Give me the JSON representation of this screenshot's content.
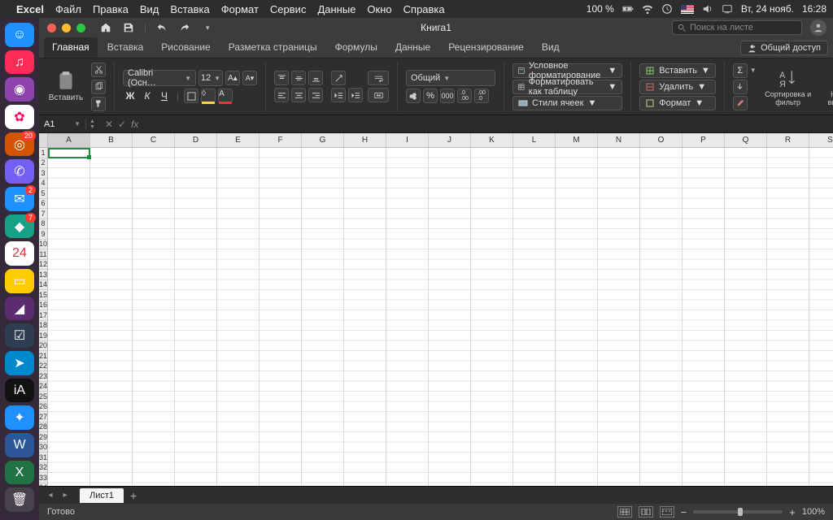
{
  "menubar": {
    "app": "Excel",
    "items": [
      "Файл",
      "Правка",
      "Вид",
      "Вставка",
      "Формат",
      "Сервис",
      "Данные",
      "Окно",
      "Справка"
    ],
    "battery": "100 %",
    "date": "Вт, 24 нояб.",
    "time": "16:28"
  },
  "dock": {
    "apps": [
      {
        "name": "finder",
        "bg": "#1e90ff",
        "glyph": "☺"
      },
      {
        "name": "music",
        "bg": "#ff2d55",
        "glyph": "♫"
      },
      {
        "name": "podcasts",
        "bg": "#8e44ad",
        "glyph": "◉"
      },
      {
        "name": "photos",
        "bg": "#ffffff",
        "glyph": "✿",
        "fg": "#f06"
      },
      {
        "name": "app-red",
        "bg": "#d35400",
        "glyph": "◎",
        "badge": "20"
      },
      {
        "name": "viber",
        "bg": "#7360f2",
        "glyph": "✆"
      },
      {
        "name": "mail",
        "bg": "#1e90ff",
        "glyph": "✉",
        "badge": "2"
      },
      {
        "name": "app-teal",
        "bg": "#16a085",
        "glyph": "◆",
        "badge": "7"
      },
      {
        "name": "calendar",
        "bg": "#ffffff",
        "glyph": "24",
        "fg": "#d33"
      },
      {
        "name": "notes",
        "bg": "#ffcc00",
        "glyph": "▭"
      },
      {
        "name": "affinity",
        "bg": "#5b2c6f",
        "glyph": "◢"
      },
      {
        "name": "todo",
        "bg": "#2c3e50",
        "glyph": "☑"
      },
      {
        "name": "telegram",
        "bg": "#0088cc",
        "glyph": "➤"
      },
      {
        "name": "ia-writer",
        "bg": "#111",
        "glyph": "iA"
      },
      {
        "name": "safari",
        "bg": "#1e90ff",
        "glyph": "✦"
      },
      {
        "name": "word",
        "bg": "#2b579a",
        "glyph": "W"
      },
      {
        "name": "excel",
        "bg": "#217346",
        "glyph": "X"
      }
    ]
  },
  "window": {
    "title": "Книга1",
    "search_placeholder": "Поиск на листе",
    "share_label": "Общий доступ"
  },
  "ribbon": {
    "tabs": [
      "Главная",
      "Вставка",
      "Рисование",
      "Разметка страницы",
      "Формулы",
      "Данные",
      "Рецензирование",
      "Вид"
    ],
    "active_tab": 0,
    "paste_label": "Вставить",
    "font_name": "Calibri (Осн…",
    "font_size": "12",
    "bold": "Ж",
    "italic": "К",
    "underline": "Ч",
    "number_format": "Общий",
    "dec_btns": [
      ".0",
      ".00"
    ],
    "cf_label": "Условное форматирование",
    "fat_label": "Форматировать как таблицу",
    "cs_label": "Стили ячеек",
    "insert_label": "Вставить",
    "delete_label": "Удалить",
    "format_label": "Формат",
    "sort_label": "Сортировка и фильтр",
    "find_label": "Найти и выделить"
  },
  "formula": {
    "cell_ref": "A1",
    "fx": "fx",
    "value": ""
  },
  "grid": {
    "columns": [
      "A",
      "B",
      "C",
      "D",
      "E",
      "F",
      "G",
      "H",
      "I",
      "J",
      "K",
      "L",
      "M",
      "N",
      "O",
      "P",
      "Q",
      "R",
      "S"
    ],
    "row_count": 35,
    "selected": "A1"
  },
  "sheets": {
    "active": "Лист1"
  },
  "status": {
    "ready": "Готово",
    "zoom": "100%"
  }
}
